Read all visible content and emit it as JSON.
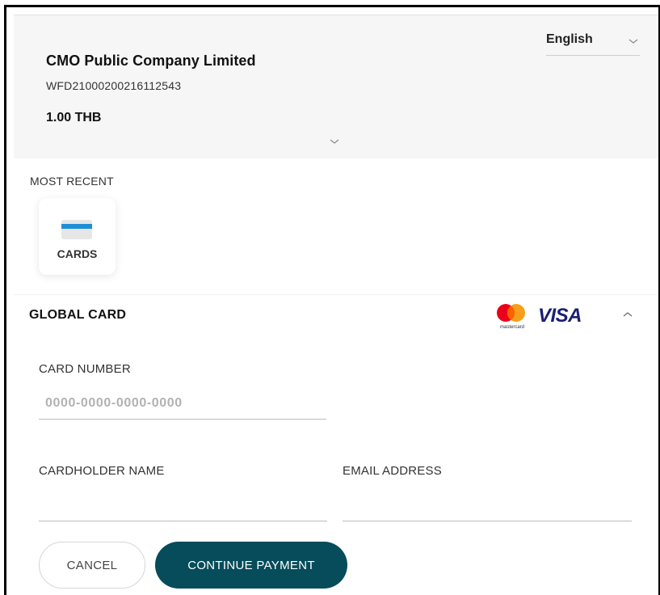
{
  "header": {
    "merchant_name": "CMO Public Company Limited",
    "order_id": "WFD21000200216112543",
    "amount": "1.00 THB",
    "background": "#f6f6f6"
  },
  "language": {
    "selected": "English",
    "icon": "chevron-down-icon"
  },
  "recent": {
    "title": "MOST RECENT",
    "methods": [
      {
        "label": "CARDS",
        "icon": "credit-card-icon"
      }
    ]
  },
  "card_section": {
    "title": "GLOBAL CARD",
    "brands": [
      "mastercard",
      "VISA"
    ],
    "mastercard_caption": "mastercard",
    "visa_label": "VISA",
    "fields": {
      "card_number": {
        "label": "CARD NUMBER",
        "placeholder": "0000-0000-0000-0000",
        "value": ""
      },
      "cardholder_name": {
        "label": "CARDHOLDER NAME",
        "placeholder": "",
        "value": ""
      },
      "email": {
        "label": "EMAIL ADDRESS",
        "placeholder": "",
        "value": ""
      }
    }
  },
  "actions": {
    "cancel_label": "CANCEL",
    "continue_label": "CONTINUE PAYMENT",
    "primary_color": "#064c5b"
  }
}
